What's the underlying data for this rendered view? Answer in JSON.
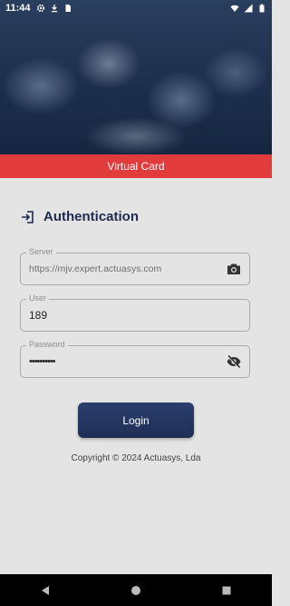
{
  "status_bar": {
    "time": "11:44"
  },
  "banner": {
    "label": "Virtual Card"
  },
  "auth": {
    "title": "Authentication"
  },
  "form": {
    "server": {
      "label": "Server",
      "value": "https://mjv.expert.actuasys.com"
    },
    "user": {
      "label": "User",
      "value": "189"
    },
    "password": {
      "label": "Password",
      "value": "••••••••••"
    }
  },
  "login": {
    "label": "Login"
  },
  "footer": {
    "copyright": "Copyright © 2024 Actuasys, Lda"
  },
  "colors": {
    "banner": "#e23b3b",
    "accent": "#1e2a4d",
    "button": "#24365f",
    "background": "#e4e4e4"
  },
  "icons": [
    "gear-icon",
    "download-icon",
    "sim-icon",
    "wifi-icon",
    "signal-icon",
    "battery-icon",
    "login-icon",
    "camera-icon",
    "eye-off-icon",
    "back-icon",
    "home-icon",
    "recents-icon"
  ]
}
